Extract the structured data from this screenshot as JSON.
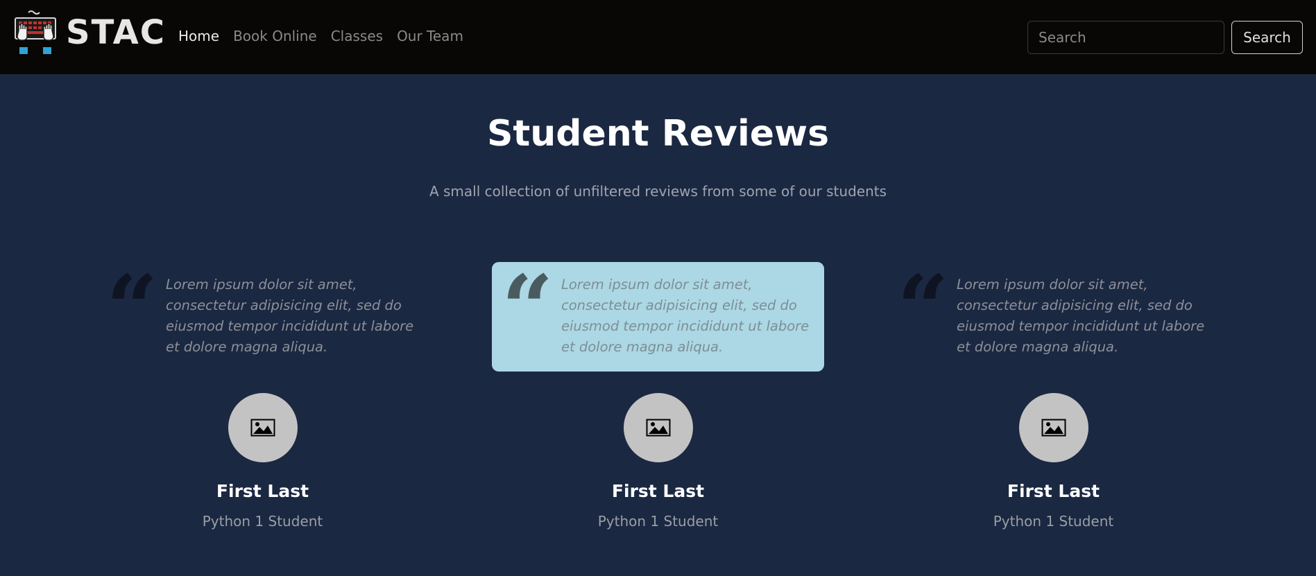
{
  "brand": {
    "name": "STAC",
    "logo_icon": "keyboard-hands-icon"
  },
  "nav": {
    "links": [
      {
        "label": "Home",
        "active": true
      },
      {
        "label": "Book Online",
        "active": false
      },
      {
        "label": "Classes",
        "active": false
      },
      {
        "label": "Our Team",
        "active": false
      }
    ]
  },
  "search": {
    "placeholder": "Search",
    "value": "",
    "button_label": "Search"
  },
  "section": {
    "title": "Student Reviews",
    "subtitle": "A small collection of unfiltered reviews from some of our students"
  },
  "reviews": [
    {
      "quote_mark": "“",
      "text": "Lorem ipsum dolor sit amet, consectetur adipisicing elit, sed do eiusmod tempor incididunt ut labore et dolore magna aliqua.",
      "avatar_icon": "image-placeholder-icon",
      "name": "First Last",
      "role": "Python 1 Student",
      "highlighted": false
    },
    {
      "quote_mark": "“",
      "text": "Lorem ipsum dolor sit amet, consectetur adipisicing elit, sed do eiusmod tempor incididunt ut labore et dolore magna aliqua.",
      "avatar_icon": "image-placeholder-icon",
      "name": "First Last",
      "role": "Python 1 Student",
      "highlighted": true
    },
    {
      "quote_mark": "“",
      "text": "Lorem ipsum dolor sit amet, consectetur adipisicing elit, sed do eiusmod tempor incididunt ut labore et dolore magna aliqua.",
      "avatar_icon": "image-placeholder-icon",
      "name": "First Last",
      "role": "Python 1 Student",
      "highlighted": false
    }
  ],
  "colors": {
    "navbar_bg": "#080706",
    "page_bg": "#1b2842",
    "highlight_bg": "#acd7e5"
  }
}
